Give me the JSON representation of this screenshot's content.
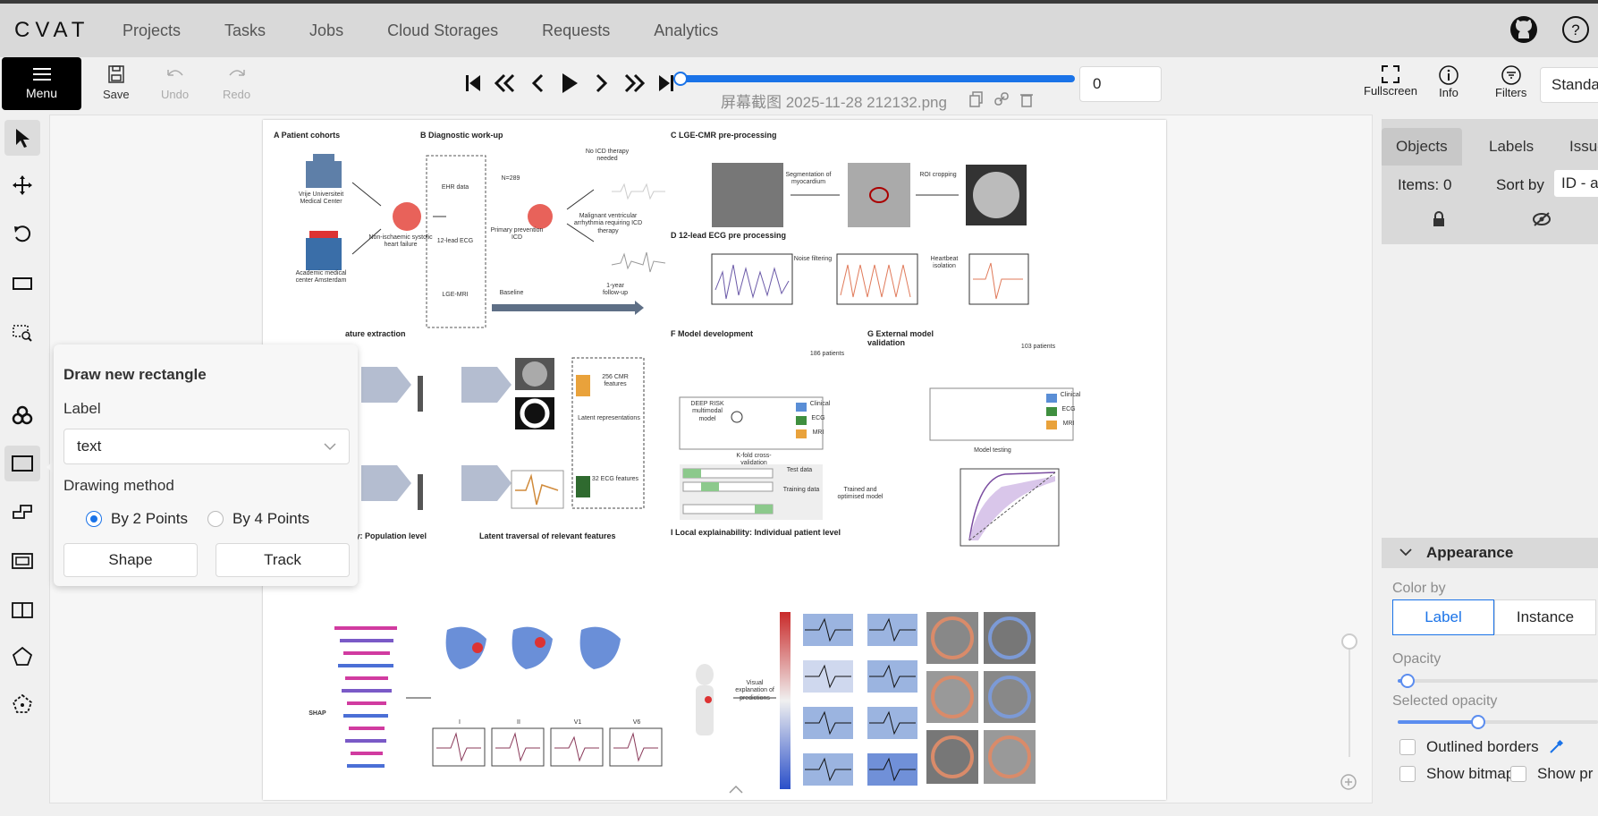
{
  "app": {
    "logo": "CVAT"
  },
  "nav": [
    "Projects",
    "Tasks",
    "Jobs",
    "Cloud Storages",
    "Requests",
    "Analytics"
  ],
  "toolbar": {
    "menu_label": "Menu",
    "save_label": "Save",
    "undo_label": "Undo",
    "redo_label": "Redo",
    "filename": "屏幕截图 2025-11-28 212132.png",
    "frame_value": "0",
    "fullscreen_label": "Fullscreen",
    "info_label": "Info",
    "filters_label": "Filters",
    "workspace_value": "Standa"
  },
  "popup": {
    "title": "Draw new rectangle",
    "label_heading": "Label",
    "label_value": "text",
    "method_heading": "Drawing method",
    "method_2": "By 2 Points",
    "method_4": "By 4 Points",
    "shape_button": "Shape",
    "track_button": "Track"
  },
  "sidebar": {
    "tabs": [
      "Objects",
      "Labels",
      "Issue"
    ],
    "items_count": "Items: 0",
    "sort_by": "Sort by",
    "sort_value": "ID - a",
    "appearance": "Appearance",
    "color_by": "Color by",
    "color_options": [
      "Label",
      "Instance"
    ],
    "opacity_label": "Opacity",
    "opacity_value": 0.05,
    "selected_opacity_label": "Selected opacity",
    "selected_opacity_value": 0.4,
    "outlined_borders": "Outlined borders",
    "show_bitmap": "Show bitmap",
    "show_projections": "Show pr"
  },
  "figure": {
    "A": "A   Patient cohorts",
    "B": "B   Diagnostic work-up",
    "C": "C   LGE-CMR pre-processing",
    "D": "D   12-lead ECG pre processing",
    "F": "F   Model development",
    "G": "G   External model validation",
    "H": "H   Global explainability: Population level",
    "I": "I   Local explainability: Individual patient level",
    "latent": "Latent traversal of relevant features",
    "feat_extract": "ature extraction",
    "vumc": "Vrije Universiteit Medical Center",
    "amc": "Academic medical center Amsterdam",
    "nish": "Non-ischaemic systolic heart failure",
    "n289": "N=289",
    "ppicd": "Primary prevention ICD",
    "noicd": "No ICD therapy needed",
    "mva": "Malignant ventricular arrhythmia requiring ICD therapy",
    "ehr": "EHR data",
    "ecg12": "12-lead ECG",
    "lgemri": "LGE-MRI",
    "baseline": "Baseline",
    "followup": "1-year follow-up",
    "segm": "Segmentation of myocardium",
    "roi": "ROI cropping",
    "noise": "Noise filtering",
    "heartbeat": "Heartbeat isolation",
    "cmr256": "256 CMR features",
    "ecg32": "32 ECG features",
    "latent_rep": "Latent representations",
    "p186": "186 patients",
    "p103": "103 patients",
    "deeprisk": "DEEP RISK multimodal model",
    "clinical": "Clinical",
    "ecg": "ECG",
    "mri": "MRI",
    "kfold": "K-fold cross-validation",
    "testdata": "Test data",
    "trainingdata": "Training data",
    "trained": "Trained and optimised model",
    "modeltesting": "Model testing",
    "shap": "SHAP",
    "visual": "Visual explanation of predictions",
    "leads": [
      "I",
      "II",
      "V1",
      "V6"
    ]
  }
}
